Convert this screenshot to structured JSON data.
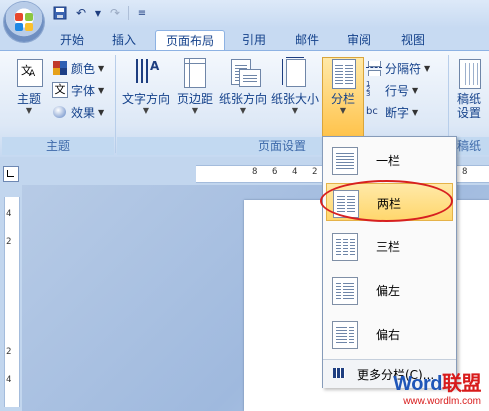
{
  "tabs": [
    "开始",
    "插入",
    "页面布局",
    "引用",
    "邮件",
    "审阅",
    "视图"
  ],
  "active_tab": "页面布局",
  "groups": {
    "theme": {
      "label": "主题",
      "big_button": "主题",
      "items": [
        "颜色",
        "字体",
        "效果"
      ]
    },
    "page_setup": {
      "label": "页面设置",
      "buttons": [
        "文字方向",
        "页边距",
        "纸张方向",
        "纸张大小",
        "分栏"
      ],
      "small_items": [
        "分隔符",
        "行号",
        "断字"
      ]
    },
    "paper": {
      "label": "稿纸",
      "button_line1": "稿纸",
      "button_line2": "设置"
    }
  },
  "dropdown": {
    "items": [
      "一栏",
      "两栏",
      "三栏",
      "偏左",
      "偏右"
    ],
    "selected": "两栏",
    "footer": "更多分栏(C)..."
  },
  "ruler": {
    "h_numbers": [
      "8",
      "6",
      "4",
      "2",
      "8"
    ],
    "v_numbers": [
      "4",
      "2",
      "2",
      "4"
    ]
  },
  "watermark": {
    "brand_part1": "Word",
    "brand_part2": "联盟",
    "url": "www.wordlm.com"
  }
}
